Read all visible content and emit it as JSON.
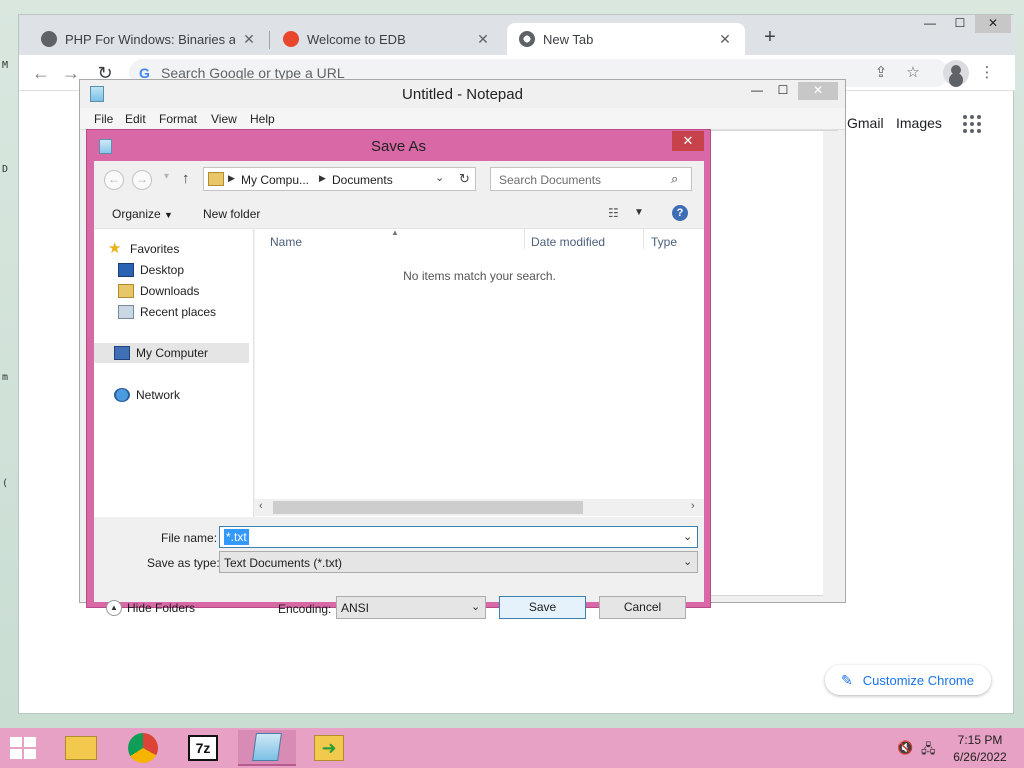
{
  "colors": {
    "dialog_frame": "#d869a6",
    "taskbar": "#e7a1c4",
    "selection": "#3399ff",
    "chrome_link": "#1a73e8"
  },
  "chrome": {
    "tabs": [
      {
        "title": "PHP For Windows: Binaries and s",
        "icon": "globe-icon"
      },
      {
        "title": "Welcome to EDB",
        "icon": "edb-icon"
      },
      {
        "title": "New Tab",
        "icon": "chrome-icon"
      }
    ],
    "new_tab_symbol": "+",
    "omnibox_placeholder": "Search Google or type a URL",
    "omnibox_g": "G",
    "links": {
      "gmail": "Gmail",
      "images": "Images"
    },
    "customize_label": "Customize Chrome",
    "window_controls": {
      "minimize": "—",
      "maximize": "☐",
      "close": "✕"
    }
  },
  "notepad": {
    "title": "Untitled - Notepad",
    "menu": [
      "File",
      "Edit",
      "Format",
      "View",
      "Help"
    ],
    "controls": {
      "minimize": "—",
      "maximize": "☐",
      "close": "✕"
    }
  },
  "save_as": {
    "title": "Save As",
    "close": "✕",
    "address": {
      "part1": "My Compu...",
      "part2": "Documents"
    },
    "search_placeholder": "Search Documents",
    "organize_label": "Organize",
    "new_folder_label": "New folder",
    "tree": {
      "favorites": "Favorites",
      "desktop": "Desktop",
      "downloads": "Downloads",
      "recent": "Recent places",
      "my_computer": "My Computer",
      "network": "Network"
    },
    "columns": {
      "name": "Name",
      "date": "Date modified",
      "type": "Type"
    },
    "empty_message": "No items match your search.",
    "file_name_label": "File name:",
    "file_name_value": "*.txt",
    "save_type_label": "Save as type:",
    "save_type_value": "Text Documents (*.txt)",
    "hide_folders_label": "Hide Folders",
    "encoding_label": "Encoding:",
    "encoding_value": "ANSI",
    "save_button": "Save",
    "cancel_button": "Cancel",
    "help_symbol": "?"
  },
  "taskbar": {
    "time": "7:15 PM",
    "date": "6/26/2022",
    "apps": [
      "file-explorer-icon",
      "chrome-icon",
      "7zip-icon",
      "notepad-icon",
      "arrow-app-icon"
    ],
    "seven_zip_label": "7z"
  }
}
